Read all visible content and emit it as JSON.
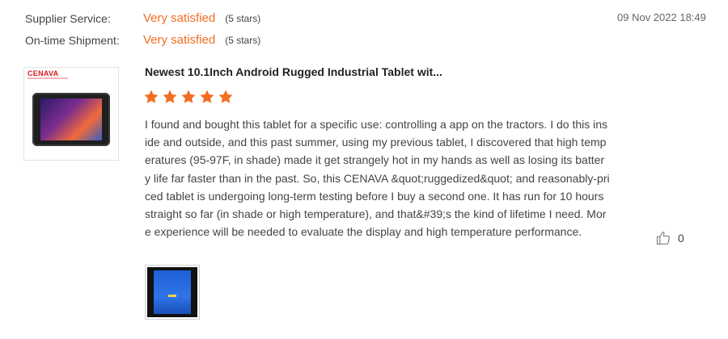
{
  "ratings": [
    {
      "label": "Supplier Service:",
      "value": "Very satisfied",
      "count": "(5 stars)"
    },
    {
      "label": "On-time Shipment:",
      "value": "Very satisfied",
      "count": "(5 stars)"
    }
  ],
  "review": {
    "date": "09 Nov 2022 18:49",
    "product_title": "Newest 10.1Inch Android Rugged Industrial Tablet wit...",
    "product_brand": "CENAVA",
    "stars": 5,
    "text": "I found and bought this tablet for a specific use: controlling a app on the tractors. I do this inside and outside, and this past summer, using my previous tablet, I discovered that high temperatures (95-97F, in shade) made it get strangely hot in my hands as well as losing its battery life far faster than in the past. So, this CENAVA &quot;ruggedized&quot; and reasonably-priced tablet is undergoing long-term testing before I buy a second one.  It has run for 10 hours straight so far (in shade or high temperature), and that&#39;s the kind of lifetime I need. More experience will be needed to evaluate the display and high temperature performance.",
    "likes": "0"
  },
  "colors": {
    "accent": "#f26d21",
    "star": "#f26d21",
    "brand": "#d71920"
  },
  "icons": {
    "star": "star-icon",
    "like": "thumbs-up-icon"
  }
}
